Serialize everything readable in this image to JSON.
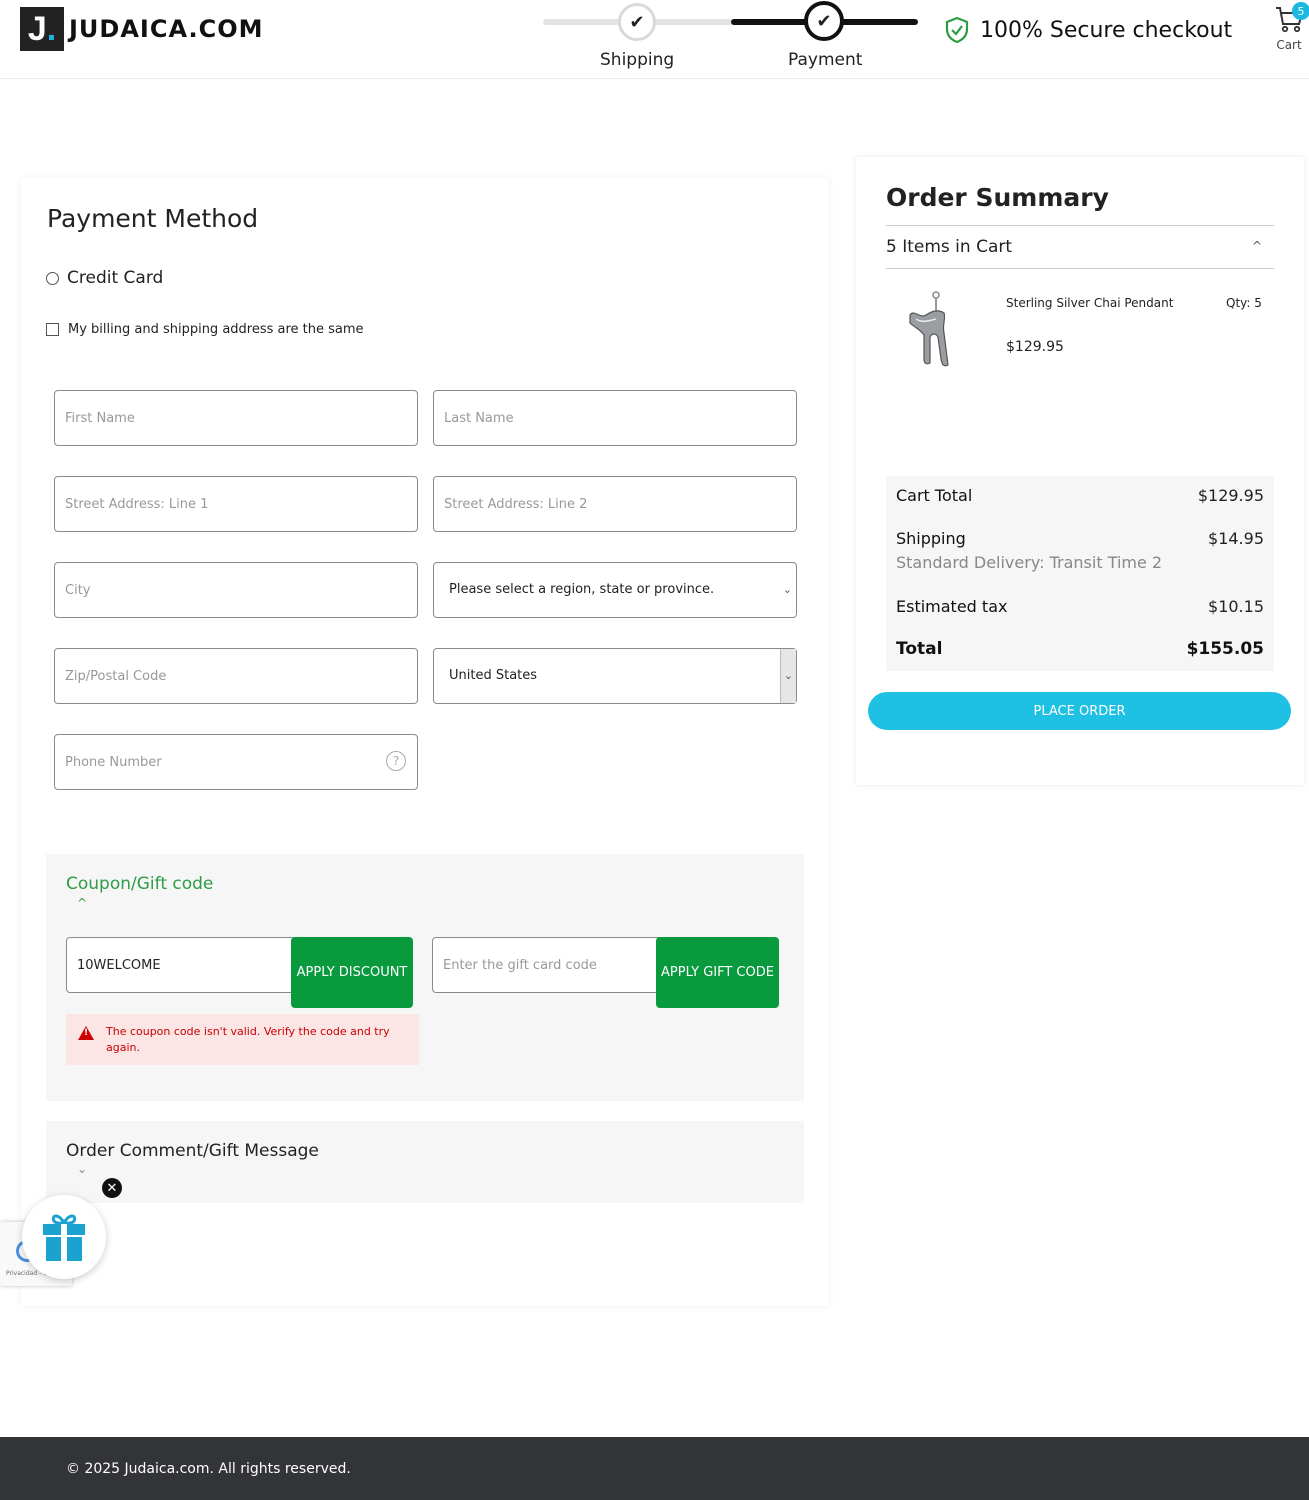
{
  "header": {
    "logo_letter": "J",
    "logo_text": "JUDAICA.COM",
    "steps": [
      {
        "label": "Shipping",
        "state": "done"
      },
      {
        "label": "Payment",
        "state": "active"
      }
    ],
    "secure_text": "100% Secure checkout",
    "cart_label": "Cart",
    "cart_count": "5"
  },
  "payment": {
    "title": "Payment Method",
    "method_label": "Credit Card",
    "billing_same_label": "My billing and shipping address are the same",
    "fields": {
      "first_name": "First Name",
      "last_name": "Last Name",
      "street1": "Street Address: Line 1",
      "street2": "Street Address: Line 2",
      "city": "City",
      "region": "Please select a region, state or province.",
      "zip": "Zip/Postal Code",
      "country": "United States",
      "phone": "Phone Number"
    }
  },
  "coupon": {
    "title": "Coupon/Gift code",
    "code_value": "10WELCOME",
    "apply_discount": "APPLY DISCOUNT",
    "gift_placeholder": "Enter the gift card code",
    "apply_gift": "APPLY GIFT CODE",
    "error": "The coupon code isn't valid. Verify the code and try again."
  },
  "comment": {
    "title": "Order Comment/Gift Message"
  },
  "summary": {
    "title": "Order Summary",
    "items_in_cart": "5 Items in Cart",
    "product": {
      "name": "Sterling Silver Chai Pendant",
      "qty": "Qty: 5",
      "price": "$129.95"
    },
    "totals": {
      "cart_total_label": "Cart Total",
      "cart_total": "$129.95",
      "shipping_label": "Shipping",
      "shipping_method": "Standard Delivery: Transit Time 2",
      "shipping": "$14.95",
      "tax_label": "Estimated tax",
      "tax": "$10.15",
      "total_label": "Total",
      "total": "$155.05"
    },
    "place_order": "PLACE ORDER"
  },
  "footer": {
    "copyright": "© 2025 Judaica.com. All rights reserved."
  },
  "widgets": {
    "recaptcha_text": "Privacidad - Cond.",
    "gift_icon": "gift-icon",
    "close_icon": "close-icon"
  },
  "colors": {
    "accent": "#1ec0e3",
    "green": "#0a9a3e",
    "coupon_title": "#2e9b45",
    "error": "#c00000",
    "footer_bg": "#333437"
  }
}
